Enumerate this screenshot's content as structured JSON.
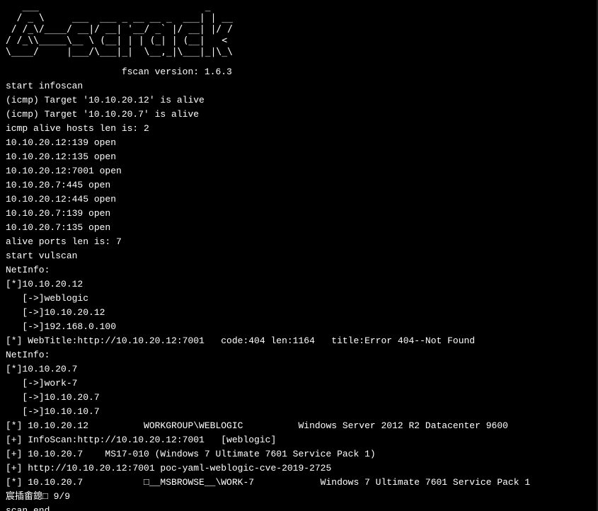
{
  "terminal": {
    "banner": "   ___                              _    \n  / _ \\     ___  ___ _ __ __ _  ___| | __ \n / /_\\/____/ __|/ __| '__/ _` |/ __| |/ /\n/ /_\\\\_____\\__ \\ (__| | | (_| | (__|   <  \n\\____/     |___/\\___|_|  \\__,_|\\___|_|\\_\\ ",
    "lines": [
      "                     fscan version: 1.6.3",
      "start infoscan",
      "(icmp) Target '10.10.20.12' is alive",
      "(icmp) Target '10.10.20.7' is alive",
      "icmp alive hosts len is: 2",
      "10.10.20.12:139 open",
      "10.10.20.12:135 open",
      "10.10.20.12:7001 open",
      "10.10.20.7:445 open",
      "10.10.20.12:445 open",
      "10.10.20.7:139 open",
      "10.10.20.7:135 open",
      "alive ports len is: 7",
      "start vulscan",
      "NetInfo:",
      "[*]10.10.20.12",
      "   [->]weblogic",
      "   [->]10.10.20.12",
      "   [->]192.168.0.100",
      "[*] WebTitle:http://10.10.20.12:7001   code:404 len:1164   title:Error 404--Not Found",
      "NetInfo:",
      "[*]10.10.20.7",
      "   [->]work-7",
      "   [->]10.10.20.7",
      "   [->]10.10.10.7",
      "[*] 10.10.20.12          WORKGROUP\\WEBLOGIC          Windows Server 2012 R2 Datacenter 9600",
      "[+] InfoScan:http://10.10.20.12:7001   [weblogic]",
      "[+] 10.10.20.7    MS17-010 (Windows 7 Ultimate 7601 Service Pack 1)",
      "[+] http://10.10.20.12:7001 poc-yaml-weblogic-cve-2019-2725",
      "[*] 10.10.20.7           □__MSBROWSE__\\WORK-7            Windows 7 Ultimate 7601 Service Pack 1",
      "宸插畬鎴□ 9/9",
      "scan end"
    ]
  }
}
